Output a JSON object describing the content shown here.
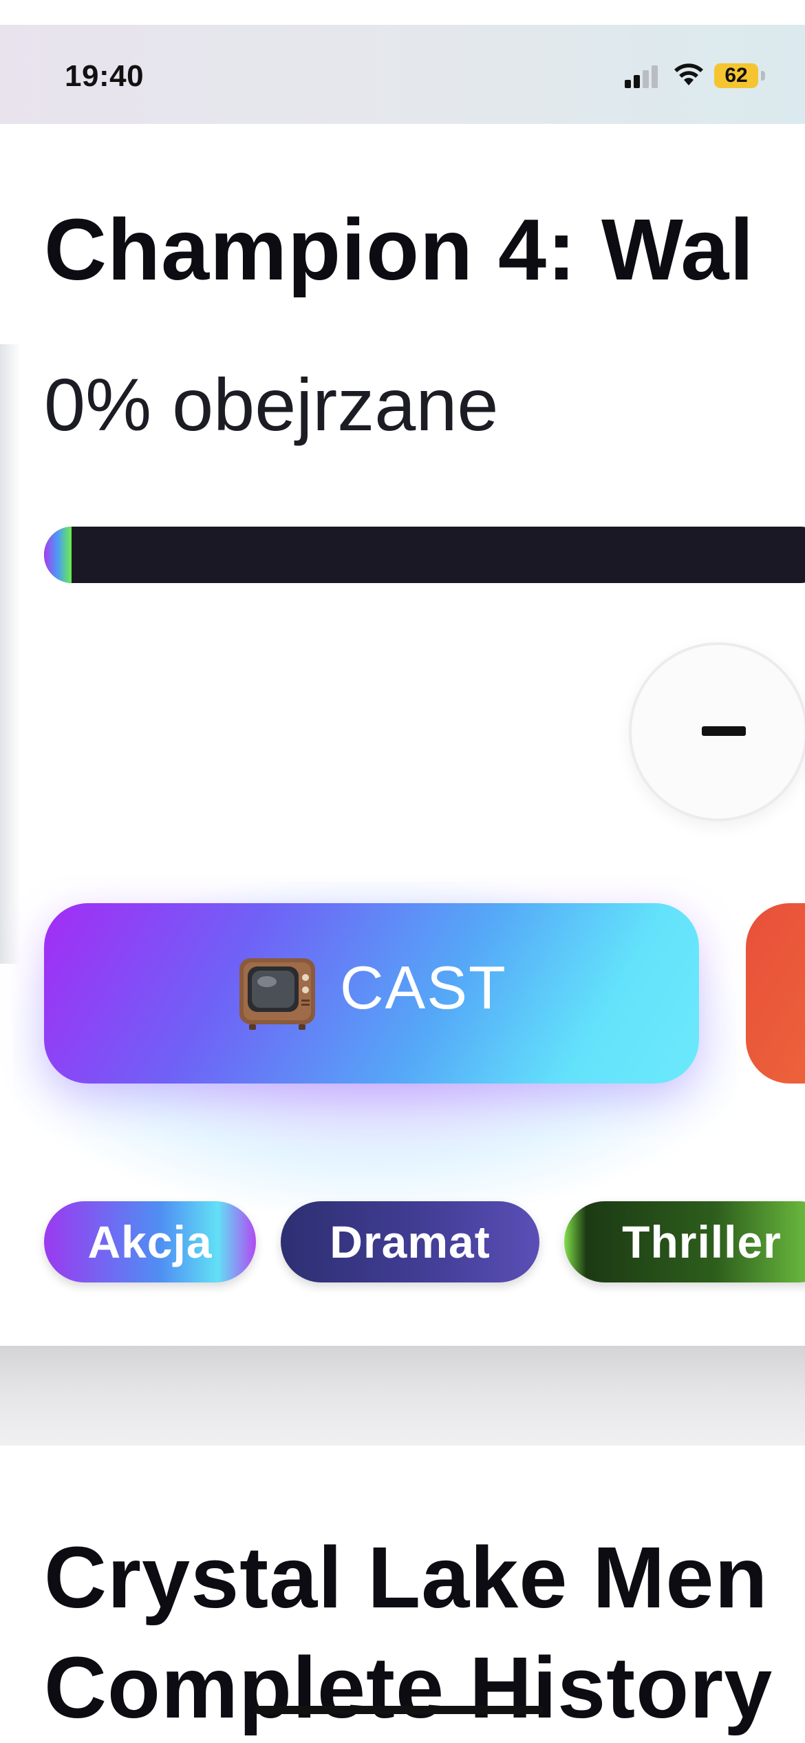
{
  "status_bar": {
    "time": "19:40",
    "battery_level": "62",
    "icons": [
      "signal-icon",
      "wifi-icon",
      "battery-icon"
    ]
  },
  "episode_card": {
    "title": "Champion 4: Wal",
    "progress_text": "0% obejrzane",
    "progress_fraction": 0.02,
    "minus_button_symbol": "−",
    "cast_button": {
      "icon": "tv-icon",
      "label": "CAST"
    },
    "genres": [
      "Akcja",
      "Dramat",
      "Thriller"
    ]
  },
  "next_card": {
    "title_line1": "Crystal Lake Men",
    "title_line2": "Complete History"
  },
  "colors": {
    "progress_track": "#1b1826",
    "cast_gradient_start": "#a32cf5",
    "cast_gradient_end": "#6ce9fb",
    "secondary_button": "#e8503a",
    "battery": "#f5c531"
  }
}
